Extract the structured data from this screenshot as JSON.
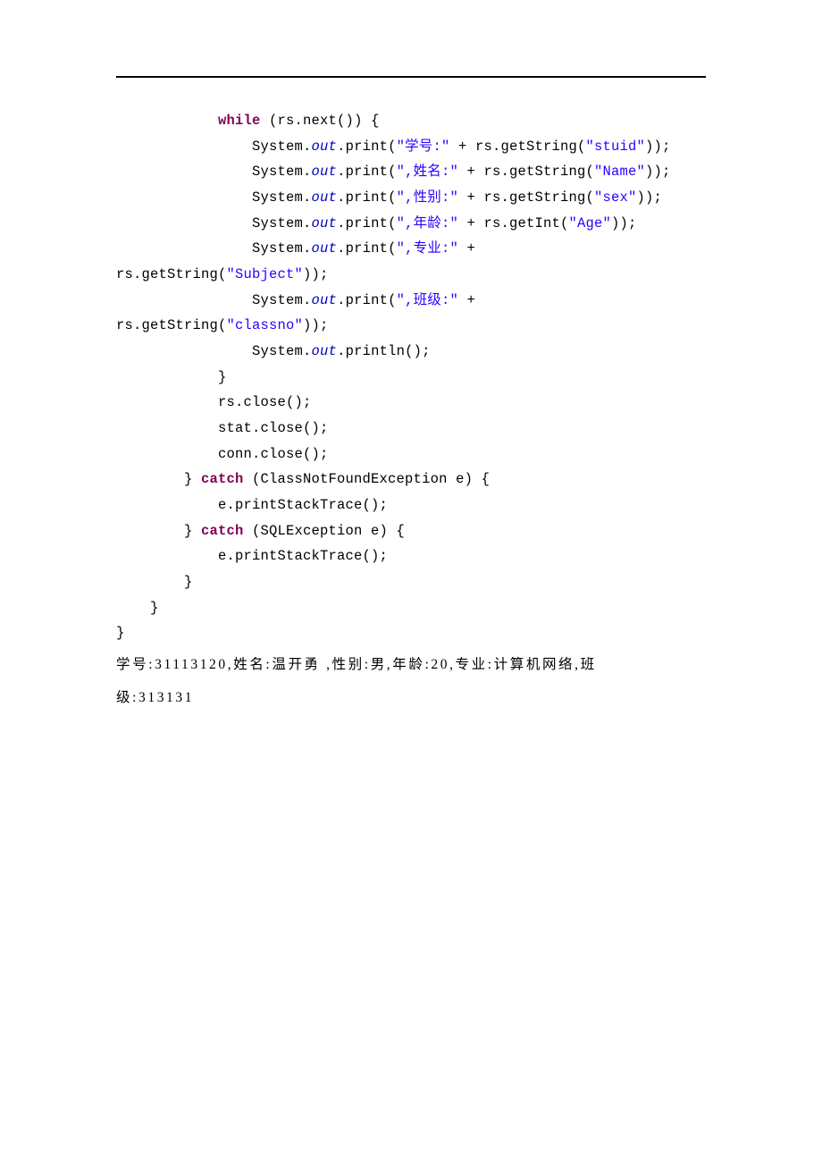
{
  "code": {
    "kw_while": "while",
    "kw_catch1": "catch",
    "kw_catch2": "catch",
    "out1": "out",
    "out2": "out",
    "out3": "out",
    "out4": "out",
    "out5": "out",
    "out6": "out",
    "out7": "out",
    "s_stuid_label": "\"学号:\"",
    "s_stuid_key": "\"stuid\"",
    "s_name_label": "\",姓名:\"",
    "s_name_key": "\"Name\"",
    "s_sex_label": "\",性别:\"",
    "s_sex_key": "\"sex\"",
    "s_age_label": "\",年龄:\"",
    "s_age_key": "\"Age\"",
    "s_subject_label": "\",专业:\"",
    "s_subject_key": "\"Subject\"",
    "s_classno_label": "\",班级:\"",
    "s_classno_key": "\"classno\"",
    "t_while_head_a": "            ",
    "t_while_head_b": " (rs.next()) {",
    "t_print1_a": "                System.",
    "t_print1_b": ".print(",
    "t_print1_c": " + rs.getString(",
    "t_print1_d": "));",
    "t_print2_a": "                System.",
    "t_print2_b": ".print(",
    "t_print2_c": " + rs.getString(",
    "t_print2_d": "));",
    "t_print3_a": "                System.",
    "t_print3_b": ".print(",
    "t_print3_c": " + rs.getString(",
    "t_print3_d": "));",
    "t_print4_a": "                System.",
    "t_print4_b": ".print(",
    "t_print4_c": " + rs.getInt(",
    "t_print4_d": "));",
    "t_print5_a": "                System.",
    "t_print5_b": ".print(",
    "t_print5_c": " +",
    "t_print5_wrap_a": "rs.getString(",
    "t_print5_wrap_b": "));",
    "t_print6_a": "                System.",
    "t_print6_b": ".print(",
    "t_print6_c": " +",
    "t_print6_wrap_a": "rs.getString(",
    "t_print6_wrap_b": "));",
    "t_print7_a": "                System.",
    "t_print7_b": ".println();",
    "t_close_while": "            }",
    "t_rs_close": "            rs.close();",
    "t_stat_close": "            stat.close();",
    "t_conn_close": "            conn.close();",
    "t_catch1_a": "        } ",
    "t_catch1_b": " (ClassNotFoundException e) {",
    "t_catch1_body": "            e.printStackTrace();",
    "t_catch2_a": "        } ",
    "t_catch2_b": " (SQLException e) {",
    "t_catch2_body": "            e.printStackTrace();",
    "t_close_catch": "        }",
    "t_close_method": "    }",
    "t_close_class": "}"
  },
  "output": {
    "line1": "学号:31113120,姓名:温开勇 ,性别:男,年龄:20,专业:计算机网络,班",
    "line2": "级:313131"
  }
}
